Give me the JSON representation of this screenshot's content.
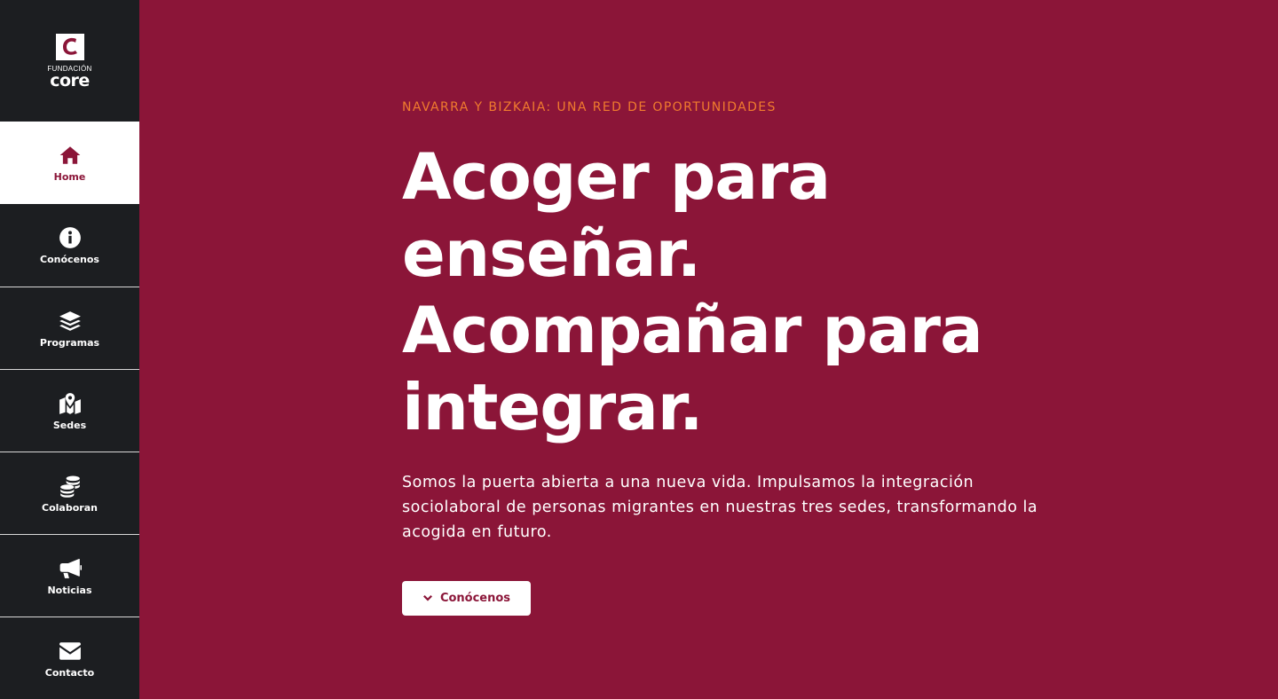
{
  "brand": {
    "logo_letter": "C",
    "sub": "FUNDACIÓN",
    "name": "core",
    "accent": "#8b1538"
  },
  "sidebar": {
    "items": [
      {
        "label": "Home",
        "icon": "home-icon",
        "active": true
      },
      {
        "label": "Conócenos",
        "icon": "info-circle-icon",
        "active": false
      },
      {
        "label": "Programas",
        "icon": "layers-icon",
        "active": false
      },
      {
        "label": "Sedes",
        "icon": "map-pin-icon",
        "active": false
      },
      {
        "label": "Colaboran",
        "icon": "coins-icon",
        "active": false
      },
      {
        "label": "Noticias",
        "icon": "megaphone-icon",
        "active": false
      },
      {
        "label": "Contacto",
        "icon": "envelope-icon",
        "active": false
      }
    ]
  },
  "hero": {
    "eyebrow": "NAVARRA Y BIZKAIA: UNA RED DE OPORTUNIDADES",
    "headline_lines": [
      "Acoger para",
      "enseñar.",
      "Acompañar para",
      "integrar."
    ],
    "intro": "Somos la puerta abierta a una nueva vida. Impulsamos la integración sociolaboral de personas migrantes en nuestras tres sedes, transformando la acogida en futuro.",
    "cta_label": "Conócenos",
    "cta_icon": "chevron-down-icon"
  },
  "colors": {
    "background": "#8b1538",
    "sidebar": "#1c1e21",
    "eyebrow": "#f07b2e"
  }
}
